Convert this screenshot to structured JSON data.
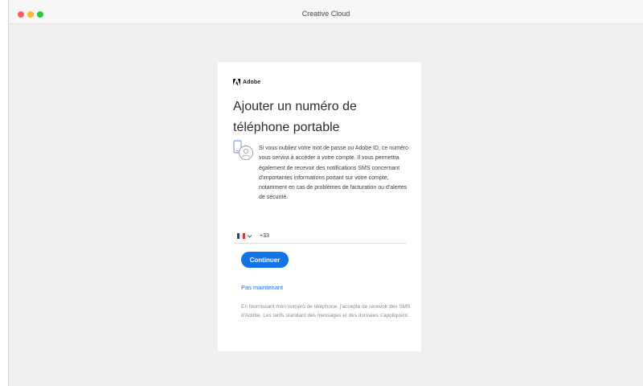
{
  "window": {
    "title": "Creative Cloud"
  },
  "card": {
    "brand": "Adobe",
    "title": "Ajouter un numéro de téléphone portable",
    "description": "Si vous oubliez votre mot de passe ou Adobe ID, ce numéro vous servira à accéder à votre compte. Il vous permettra également de recevoir des notifications SMS concernant d'importantes informations portant sur votre compte, notamment en cas de problèmes de facturation ou d'alertes de sécurité.",
    "phone": {
      "country_flag": "france-flag",
      "dial_code": "+33",
      "value": ""
    },
    "continue_label": "Continuer",
    "skip_label": "Pas maintenant",
    "disclaimer": "En fournissant mon numéro de téléphone, j'accepte de recevoir des SMS d'Adobe. Les tarifs standard des messages et des données s'appliquent."
  },
  "colors": {
    "accent": "#1473e6",
    "traffic_red": "#fe5f57",
    "traffic_yellow": "#febc2e",
    "traffic_green": "#28c840"
  }
}
